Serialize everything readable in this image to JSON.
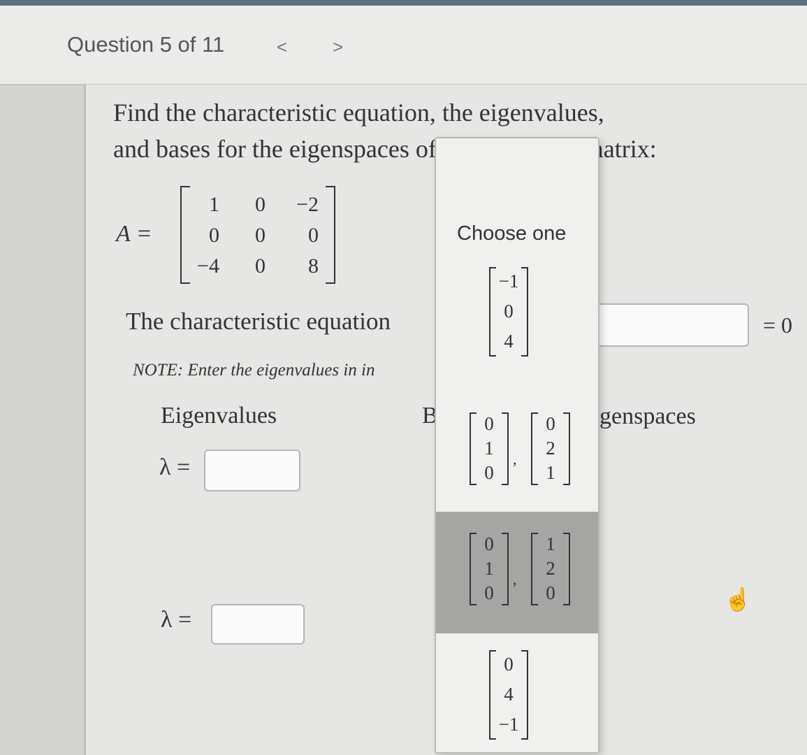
{
  "header": {
    "question": "Question 5 of 11",
    "prev": "<",
    "next": ">"
  },
  "problem": {
    "line1": "Find the characteristic equation, the eigenvalues,",
    "line2": "and bases for the eigenspaces of the following matrix:",
    "matrix_label": "A =",
    "matrix": [
      [
        "1",
        "0",
        "−2"
      ],
      [
        "0",
        "0",
        "0"
      ],
      [
        "−4",
        "0",
        "8"
      ]
    ]
  },
  "char_eq": {
    "label": "The characteristic equation",
    "rhs": "= 0"
  },
  "note": "NOTE: Enter the eigenvalues in in",
  "columns": {
    "eigenvalues": "Eigenvalues",
    "bases_partial": "B",
    "eigenspaces_partial": "genspaces"
  },
  "lambda_rows": [
    {
      "label": "λ =",
      "value": ""
    },
    {
      "label": "λ =",
      "value": ""
    }
  ],
  "dropdown": {
    "title": "Choose one",
    "options": [
      {
        "vectors": [
          [
            "−1",
            "0",
            "4"
          ]
        ],
        "highlighted": false
      },
      {
        "vectors": [
          [
            "0",
            "1",
            "0"
          ],
          [
            "0",
            "2",
            "1"
          ]
        ],
        "highlighted": false
      },
      {
        "vectors": [
          [
            "0",
            "1",
            "0"
          ],
          [
            "1",
            "2",
            "0"
          ]
        ],
        "highlighted": true
      },
      {
        "vectors": [
          [
            "0",
            "4",
            "−1"
          ]
        ],
        "highlighted": false
      }
    ]
  },
  "cursor_icon": "pointer-hand-icon"
}
